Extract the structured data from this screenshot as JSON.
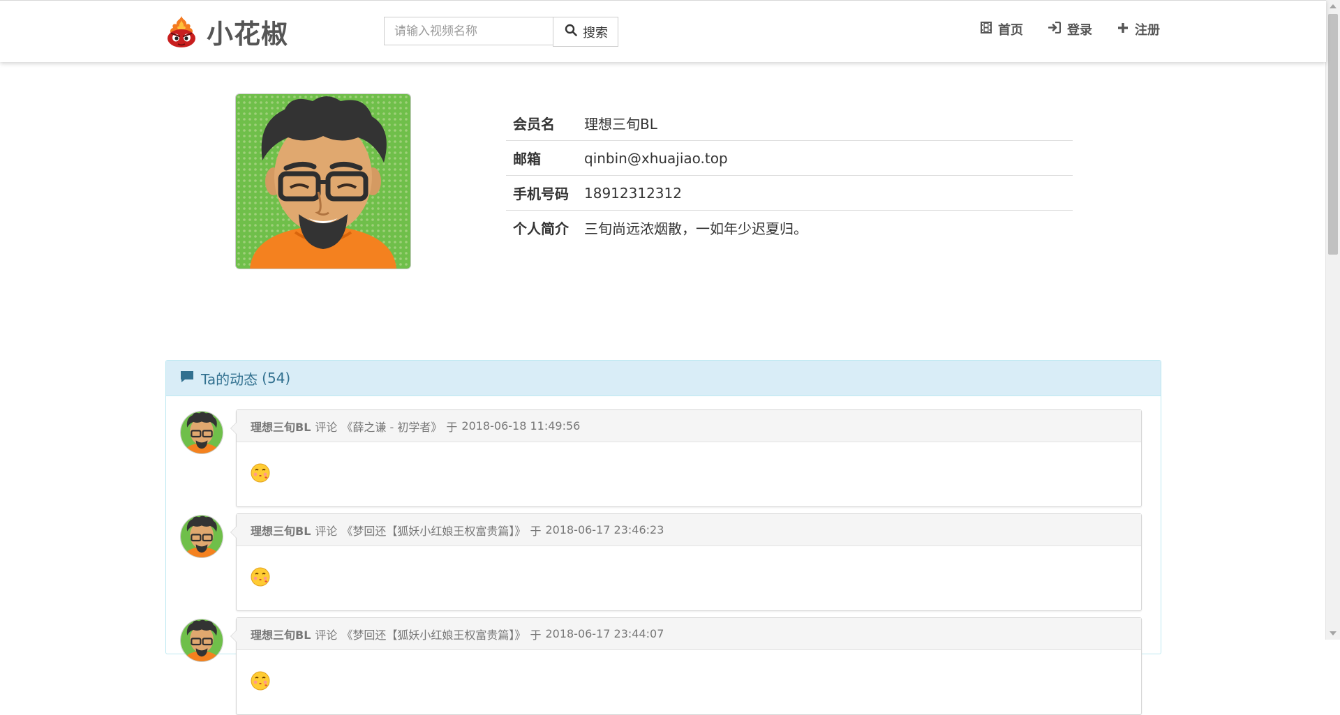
{
  "brand": {
    "name": "小花椒",
    "logo": "pepper-mascot-icon"
  },
  "search": {
    "placeholder": "请输入视频名称",
    "button_label": "搜索",
    "icon": "search-icon"
  },
  "nav": [
    {
      "label": "首页",
      "icon": "film-icon"
    },
    {
      "label": "登录",
      "icon": "login-icon"
    },
    {
      "label": "注册",
      "icon": "plus-icon"
    }
  ],
  "profile": {
    "avatar": "cartoon-man-avatar",
    "rows": [
      {
        "label": "会员名",
        "value": "理想三旬BL"
      },
      {
        "label": "邮箱",
        "value": "qinbin@xhuajiao.top"
      },
      {
        "label": "手机号码",
        "value": "18912312312"
      },
      {
        "label": "个人简介",
        "value": "三旬尚远浓烟散，一如年少迟夏归。"
      }
    ]
  },
  "activity": {
    "title": "Ta的动态",
    "count": "(54)",
    "icon": "comment-icon",
    "items": [
      {
        "user": "理想三旬BL",
        "action": "评论",
        "target": "《薛之谦 - 初学者》",
        "at": "于",
        "time": "2018-06-18 11:49:56",
        "emoji": "kiss-emoji"
      },
      {
        "user": "理想三旬BL",
        "action": "评论",
        "target": "《梦回还【狐妖小红娘王权富贵篇】》",
        "at": "于",
        "time": "2018-06-17 23:46:23",
        "emoji": "kiss-emoji"
      },
      {
        "user": "理想三旬BL",
        "action": "评论",
        "target": "《梦回还【狐妖小红娘王权富贵篇】》",
        "at": "于",
        "time": "2018-06-17 23:44:07",
        "emoji": "kiss-emoji"
      }
    ]
  },
  "colors": {
    "panel_heading_bg": "#d9edf7",
    "panel_heading_text": "#31708f",
    "panel_border": "#bce8f1"
  }
}
